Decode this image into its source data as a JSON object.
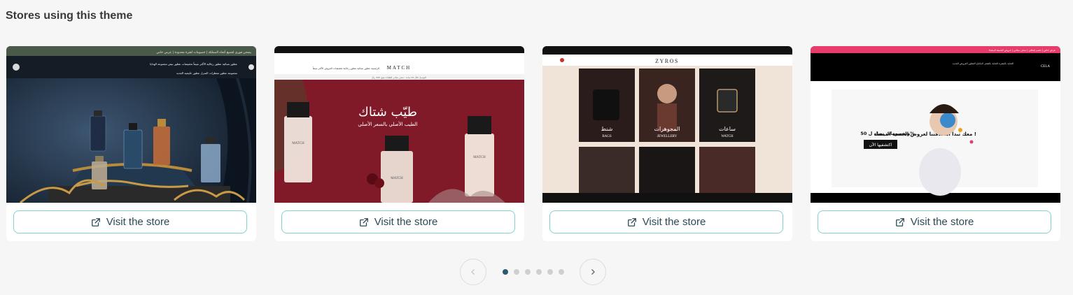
{
  "section": {
    "title": "Stores using this theme"
  },
  "stores": [
    {
      "visit_label": "Visit the store",
      "banner_text": "يشحن فوري لجميع أنحاء المملكة | خصومات لفترة محدودة | عرض خاص",
      "nav_items": [
        "عطور نسائية",
        "عطور رجالية",
        "الأكثر مبيعاً",
        "تخفيضات",
        "عطور نيش",
        "مجموعة الهدايا"
      ],
      "nav_items_2": [
        "مجموعة عطور",
        "معطرات المنزل",
        "عطور خليجية",
        "الجديد"
      ],
      "colors": {
        "bg": "#1e2c3c",
        "banner": "#4a5a4a"
      }
    },
    {
      "visit_label": "Visit the store",
      "logo": "MATCH",
      "nav_items": [
        "الرئيسية",
        "عطور نسائية",
        "عطور رجالية",
        "تخفيضات",
        "العروض",
        "الأكثر مبيعاً"
      ],
      "marquee": "التوصيل خلال 24 ساعة - شحن مجاني للطلبات فوق 200 ريال",
      "hero_title": "طيّب شتاك",
      "hero_subtitle": "الطيب الأصلي بالسعر الأصلي",
      "bottle_label": "MATCH",
      "colors": {
        "hero": "#8a1e2c"
      }
    },
    {
      "visit_label": "Visit the store",
      "logo": "ZYROS",
      "tiles": [
        {
          "ar": "شنط",
          "en": "BAGS"
        },
        {
          "ar": "المجوهرات",
          "en": "JEWELLERY"
        },
        {
          "ar": "ساعات",
          "en": "WATCH"
        }
      ],
      "colors": {
        "bg": "#f0e4d8"
      }
    },
    {
      "visit_label": "Visit the store",
      "logo": "CELA",
      "banner_text": "عرض خاص | خصم إضافي | شحن مجاني | عروض الجمعة البيضاء",
      "nav_items": [
        "العناية بالبشرة",
        "العناية بالشعر",
        "المكياج",
        "العطور",
        "العروض",
        "الجديد"
      ],
      "hero_title": "معك تبدأ انطلاقتنا لعروض الجمعة البيضاء !",
      "hero_discount": "وبخصومات تصل ل 50%",
      "hero_cta": "اكتشفيها الآن",
      "colors": {
        "banner": "#e83c6c"
      }
    }
  ],
  "pagination": {
    "pages": 6,
    "active": 0
  }
}
